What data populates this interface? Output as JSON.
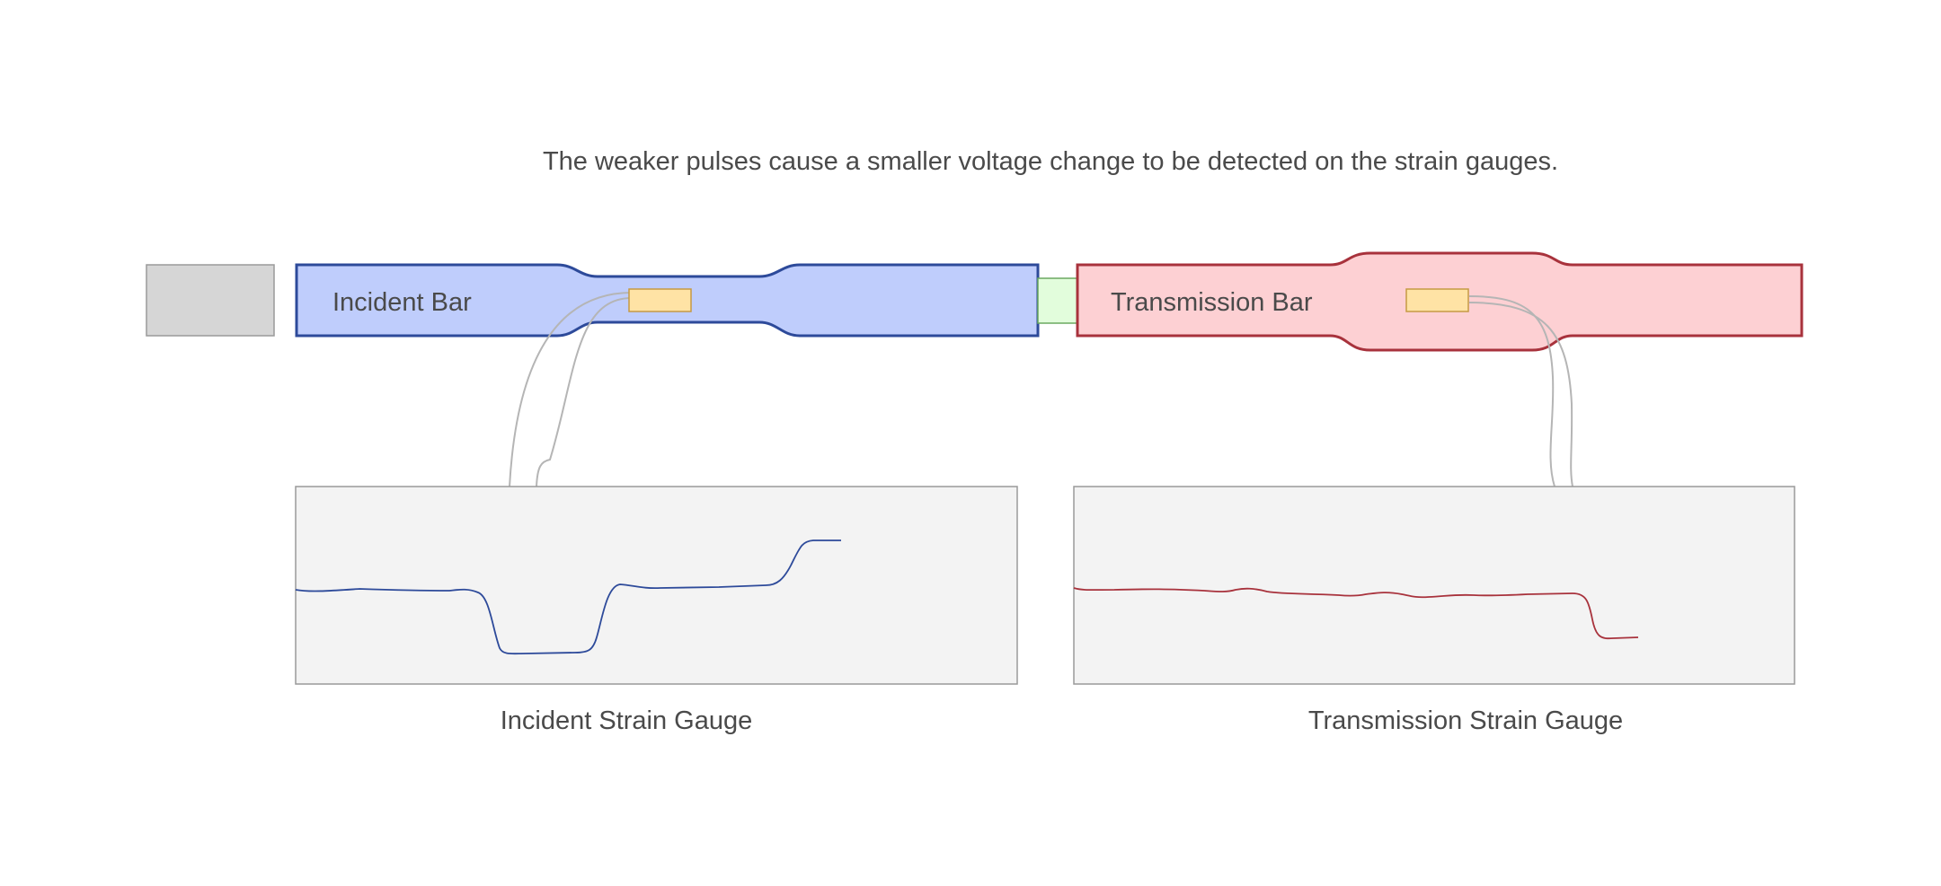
{
  "caption": "The weaker pulses cause a smaller voltage change to be detected on the strain gauges.",
  "incident_bar": {
    "label": "Incident Bar",
    "fill": "#bfcdfc",
    "stroke": "#2d4a9a"
  },
  "transmission_bar": {
    "label": "Transmission Bar",
    "fill": "#fdd0d3",
    "stroke": "#a8323c"
  },
  "striker": {
    "fill": "#d6d6d6",
    "stroke": "#9a9a9a"
  },
  "specimen": {
    "fill": "#e2fddc",
    "stroke": "#6aa860"
  },
  "strain_gauge": {
    "fill": "#ffe3a5",
    "stroke": "#c59a45"
  },
  "incident_gauge": {
    "label": "Incident Strain Gauge",
    "signal_color": "#2d4a9a"
  },
  "transmission_gauge": {
    "label": "Transmission Strain Gauge",
    "signal_color": "#a8323c"
  },
  "panel": {
    "fill": "#f3f3f3",
    "stroke": "#9a9a9a"
  },
  "wire_color": "#b5b5b5"
}
